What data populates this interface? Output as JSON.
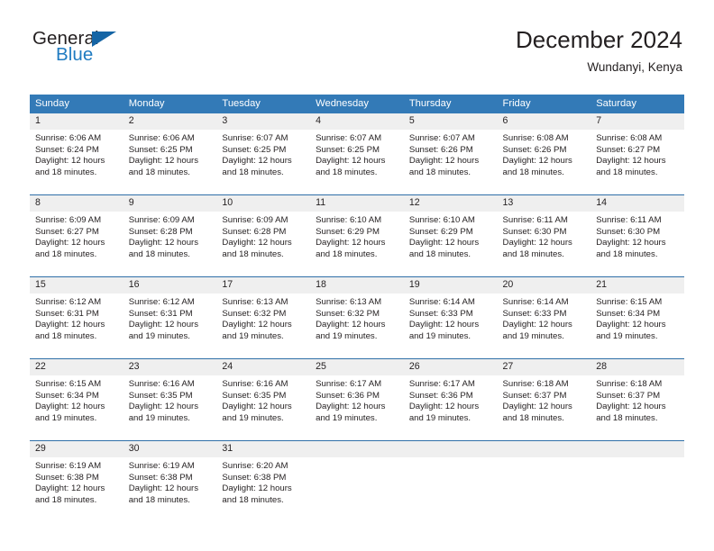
{
  "brand": {
    "name_part1": "General",
    "name_part2": "Blue",
    "flag_icon": "triangle-flag-icon"
  },
  "header": {
    "title": "December 2024",
    "location": "Wundanyi, Kenya"
  },
  "colors": {
    "header_blue": "#337ab7",
    "row_divider": "#2f6fa8",
    "daynum_background": "#efefef",
    "brand_blue": "#1f7bc1",
    "text": "#231f20"
  },
  "weekdays": [
    "Sunday",
    "Monday",
    "Tuesday",
    "Wednesday",
    "Thursday",
    "Friday",
    "Saturday"
  ],
  "weeks": [
    [
      {
        "day": "1",
        "sunrise": "Sunrise: 6:06 AM",
        "sunset": "Sunset: 6:24 PM",
        "daylight_line1": "Daylight: 12 hours",
        "daylight_line2": "and 18 minutes."
      },
      {
        "day": "2",
        "sunrise": "Sunrise: 6:06 AM",
        "sunset": "Sunset: 6:25 PM",
        "daylight_line1": "Daylight: 12 hours",
        "daylight_line2": "and 18 minutes."
      },
      {
        "day": "3",
        "sunrise": "Sunrise: 6:07 AM",
        "sunset": "Sunset: 6:25 PM",
        "daylight_line1": "Daylight: 12 hours",
        "daylight_line2": "and 18 minutes."
      },
      {
        "day": "4",
        "sunrise": "Sunrise: 6:07 AM",
        "sunset": "Sunset: 6:25 PM",
        "daylight_line1": "Daylight: 12 hours",
        "daylight_line2": "and 18 minutes."
      },
      {
        "day": "5",
        "sunrise": "Sunrise: 6:07 AM",
        "sunset": "Sunset: 6:26 PM",
        "daylight_line1": "Daylight: 12 hours",
        "daylight_line2": "and 18 minutes."
      },
      {
        "day": "6",
        "sunrise": "Sunrise: 6:08 AM",
        "sunset": "Sunset: 6:26 PM",
        "daylight_line1": "Daylight: 12 hours",
        "daylight_line2": "and 18 minutes."
      },
      {
        "day": "7",
        "sunrise": "Sunrise: 6:08 AM",
        "sunset": "Sunset: 6:27 PM",
        "daylight_line1": "Daylight: 12 hours",
        "daylight_line2": "and 18 minutes."
      }
    ],
    [
      {
        "day": "8",
        "sunrise": "Sunrise: 6:09 AM",
        "sunset": "Sunset: 6:27 PM",
        "daylight_line1": "Daylight: 12 hours",
        "daylight_line2": "and 18 minutes."
      },
      {
        "day": "9",
        "sunrise": "Sunrise: 6:09 AM",
        "sunset": "Sunset: 6:28 PM",
        "daylight_line1": "Daylight: 12 hours",
        "daylight_line2": "and 18 minutes."
      },
      {
        "day": "10",
        "sunrise": "Sunrise: 6:09 AM",
        "sunset": "Sunset: 6:28 PM",
        "daylight_line1": "Daylight: 12 hours",
        "daylight_line2": "and 18 minutes."
      },
      {
        "day": "11",
        "sunrise": "Sunrise: 6:10 AM",
        "sunset": "Sunset: 6:29 PM",
        "daylight_line1": "Daylight: 12 hours",
        "daylight_line2": "and 18 minutes."
      },
      {
        "day": "12",
        "sunrise": "Sunrise: 6:10 AM",
        "sunset": "Sunset: 6:29 PM",
        "daylight_line1": "Daylight: 12 hours",
        "daylight_line2": "and 18 minutes."
      },
      {
        "day": "13",
        "sunrise": "Sunrise: 6:11 AM",
        "sunset": "Sunset: 6:30 PM",
        "daylight_line1": "Daylight: 12 hours",
        "daylight_line2": "and 18 minutes."
      },
      {
        "day": "14",
        "sunrise": "Sunrise: 6:11 AM",
        "sunset": "Sunset: 6:30 PM",
        "daylight_line1": "Daylight: 12 hours",
        "daylight_line2": "and 18 minutes."
      }
    ],
    [
      {
        "day": "15",
        "sunrise": "Sunrise: 6:12 AM",
        "sunset": "Sunset: 6:31 PM",
        "daylight_line1": "Daylight: 12 hours",
        "daylight_line2": "and 18 minutes."
      },
      {
        "day": "16",
        "sunrise": "Sunrise: 6:12 AM",
        "sunset": "Sunset: 6:31 PM",
        "daylight_line1": "Daylight: 12 hours",
        "daylight_line2": "and 19 minutes."
      },
      {
        "day": "17",
        "sunrise": "Sunrise: 6:13 AM",
        "sunset": "Sunset: 6:32 PM",
        "daylight_line1": "Daylight: 12 hours",
        "daylight_line2": "and 19 minutes."
      },
      {
        "day": "18",
        "sunrise": "Sunrise: 6:13 AM",
        "sunset": "Sunset: 6:32 PM",
        "daylight_line1": "Daylight: 12 hours",
        "daylight_line2": "and 19 minutes."
      },
      {
        "day": "19",
        "sunrise": "Sunrise: 6:14 AM",
        "sunset": "Sunset: 6:33 PM",
        "daylight_line1": "Daylight: 12 hours",
        "daylight_line2": "and 19 minutes."
      },
      {
        "day": "20",
        "sunrise": "Sunrise: 6:14 AM",
        "sunset": "Sunset: 6:33 PM",
        "daylight_line1": "Daylight: 12 hours",
        "daylight_line2": "and 19 minutes."
      },
      {
        "day": "21",
        "sunrise": "Sunrise: 6:15 AM",
        "sunset": "Sunset: 6:34 PM",
        "daylight_line1": "Daylight: 12 hours",
        "daylight_line2": "and 19 minutes."
      }
    ],
    [
      {
        "day": "22",
        "sunrise": "Sunrise: 6:15 AM",
        "sunset": "Sunset: 6:34 PM",
        "daylight_line1": "Daylight: 12 hours",
        "daylight_line2": "and 19 minutes."
      },
      {
        "day": "23",
        "sunrise": "Sunrise: 6:16 AM",
        "sunset": "Sunset: 6:35 PM",
        "daylight_line1": "Daylight: 12 hours",
        "daylight_line2": "and 19 minutes."
      },
      {
        "day": "24",
        "sunrise": "Sunrise: 6:16 AM",
        "sunset": "Sunset: 6:35 PM",
        "daylight_line1": "Daylight: 12 hours",
        "daylight_line2": "and 19 minutes."
      },
      {
        "day": "25",
        "sunrise": "Sunrise: 6:17 AM",
        "sunset": "Sunset: 6:36 PM",
        "daylight_line1": "Daylight: 12 hours",
        "daylight_line2": "and 19 minutes."
      },
      {
        "day": "26",
        "sunrise": "Sunrise: 6:17 AM",
        "sunset": "Sunset: 6:36 PM",
        "daylight_line1": "Daylight: 12 hours",
        "daylight_line2": "and 19 minutes."
      },
      {
        "day": "27",
        "sunrise": "Sunrise: 6:18 AM",
        "sunset": "Sunset: 6:37 PM",
        "daylight_line1": "Daylight: 12 hours",
        "daylight_line2": "and 18 minutes."
      },
      {
        "day": "28",
        "sunrise": "Sunrise: 6:18 AM",
        "sunset": "Sunset: 6:37 PM",
        "daylight_line1": "Daylight: 12 hours",
        "daylight_line2": "and 18 minutes."
      }
    ],
    [
      {
        "day": "29",
        "sunrise": "Sunrise: 6:19 AM",
        "sunset": "Sunset: 6:38 PM",
        "daylight_line1": "Daylight: 12 hours",
        "daylight_line2": "and 18 minutes."
      },
      {
        "day": "30",
        "sunrise": "Sunrise: 6:19 AM",
        "sunset": "Sunset: 6:38 PM",
        "daylight_line1": "Daylight: 12 hours",
        "daylight_line2": "and 18 minutes."
      },
      {
        "day": "31",
        "sunrise": "Sunrise: 6:20 AM",
        "sunset": "Sunset: 6:38 PM",
        "daylight_line1": "Daylight: 12 hours",
        "daylight_line2": "and 18 minutes."
      },
      {
        "day": "",
        "sunrise": "",
        "sunset": "",
        "daylight_line1": "",
        "daylight_line2": ""
      },
      {
        "day": "",
        "sunrise": "",
        "sunset": "",
        "daylight_line1": "",
        "daylight_line2": ""
      },
      {
        "day": "",
        "sunrise": "",
        "sunset": "",
        "daylight_line1": "",
        "daylight_line2": ""
      },
      {
        "day": "",
        "sunrise": "",
        "sunset": "",
        "daylight_line1": "",
        "daylight_line2": ""
      }
    ]
  ]
}
